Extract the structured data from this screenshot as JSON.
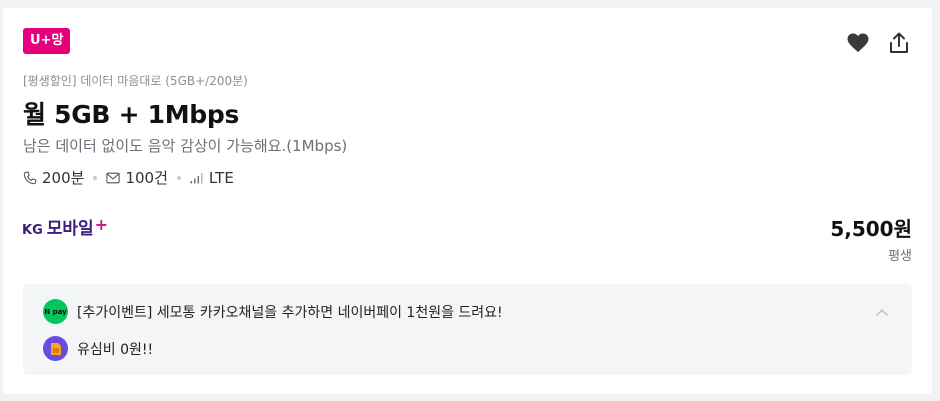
{
  "badge": {
    "label": "U+망",
    "color": "#e6007e"
  },
  "actions": {
    "favorite_icon": "heart-icon",
    "share_icon": "share-icon"
  },
  "plan": {
    "subtitle": "[평생할인] 데이터 마음대로 (5GB+/200분)",
    "title": "월 5GB + 1Mbps",
    "description": "남은 데이터 없이도 음악 감상이 가능해요.(1Mbps)",
    "specs": {
      "call": "200분",
      "sms": "100건",
      "network": "LTE"
    }
  },
  "carrier": {
    "kg": "KG",
    "name": "모바일",
    "plus": "+"
  },
  "price": {
    "amount": "5,500원",
    "period": "평생"
  },
  "events": [
    {
      "icon": "npay-icon",
      "icon_text": "N pay",
      "text": "[추가이벤트] 세모통 카카오채널을 추가하면 네이버페이 1천원을 드려요!"
    },
    {
      "icon": "sim-card-icon",
      "text": "유심비 0원!!"
    }
  ]
}
